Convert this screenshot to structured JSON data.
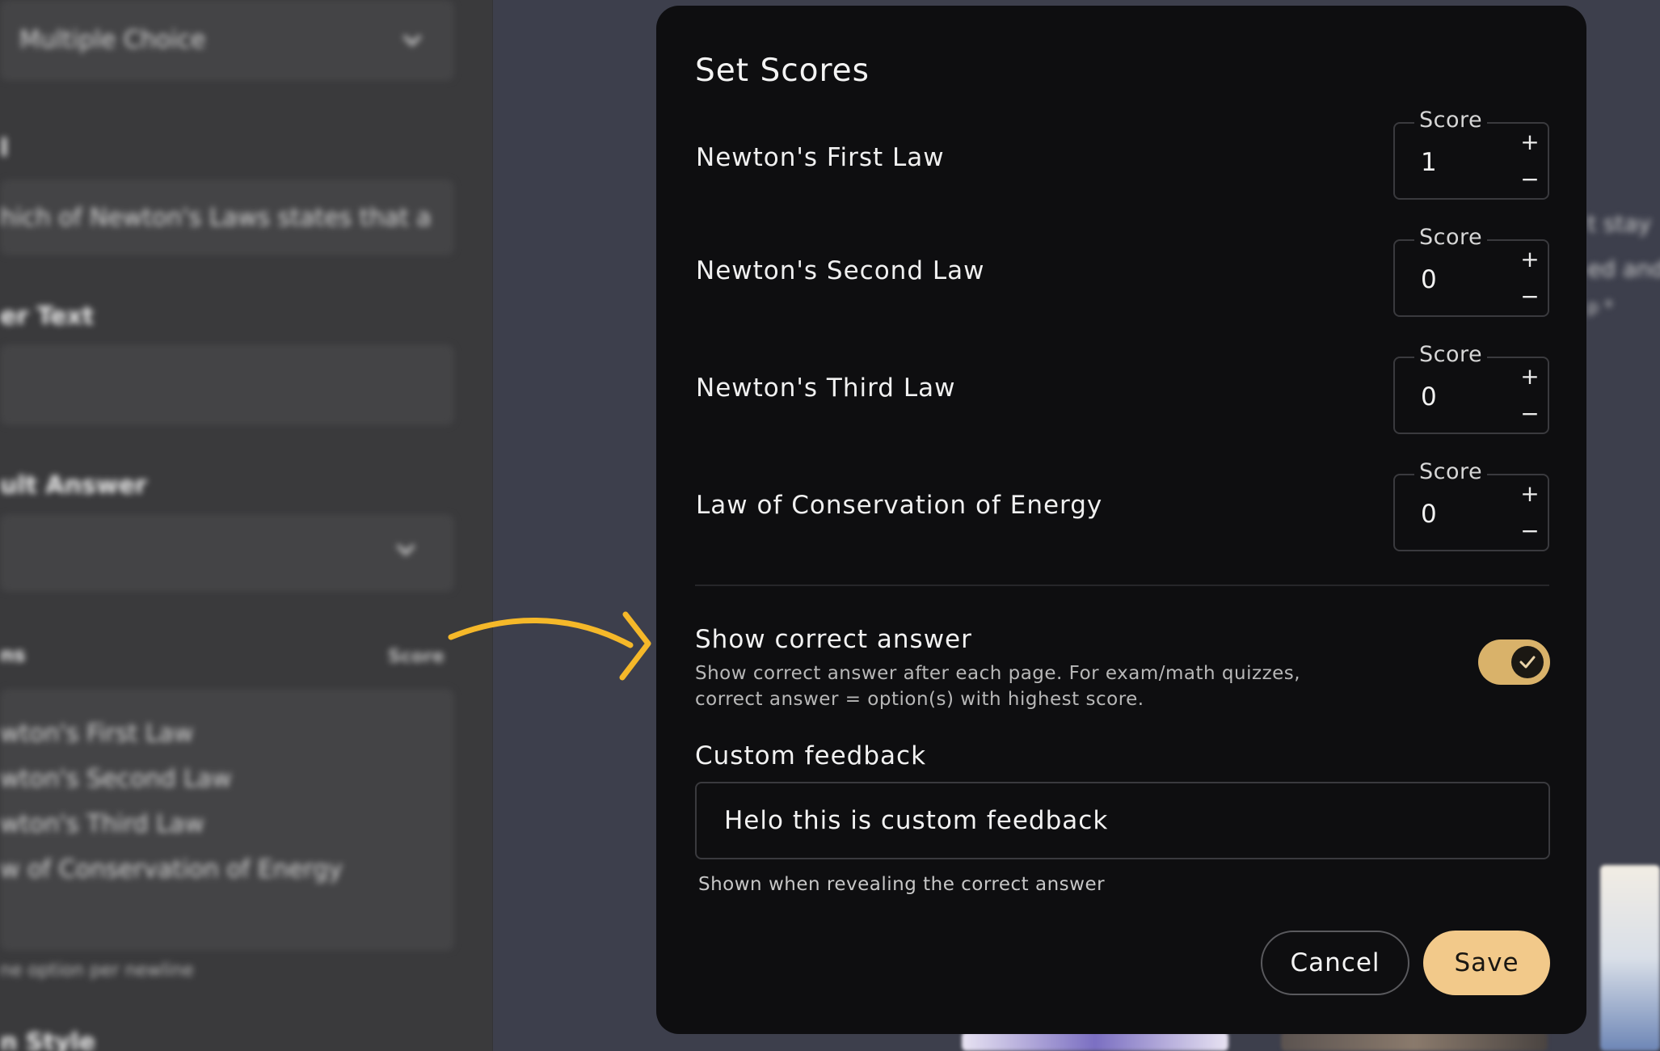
{
  "background": {
    "question_type": "Multiple Choice",
    "question_label_fragment": "l",
    "question_text_fragment": "hich of Newton's Laws states that a",
    "placeholder_label_fragment": "er Text",
    "default_answer_label_fragment": "ult Answer",
    "options_label_fragment": "ns",
    "score_link": "Score",
    "options": [
      "wton's First Law",
      "wton's Second Law",
      "wton's Third Law",
      "w of Conservation of Energy"
    ],
    "options_helper_fragment": "ne option per newline",
    "style_label_fragment": "n Style",
    "right_text_lines": [
      "t stay",
      "ed and",
      "p *"
    ]
  },
  "modal": {
    "title": "Set Scores",
    "score_field_label": "Score",
    "stepper_up": "+",
    "stepper_down": "−",
    "rows": [
      {
        "label": "Newton's First Law",
        "score": "1"
      },
      {
        "label": "Newton's Second Law",
        "score": "0"
      },
      {
        "label": "Newton's Third Law",
        "score": "0"
      },
      {
        "label": "Law of Conservation of Energy",
        "score": "0"
      }
    ],
    "show_correct": {
      "title": "Show correct answer",
      "description": "Show correct answer after each page. For exam/math quizzes, correct answer = option(s) with highest score.",
      "enabled": true
    },
    "custom_feedback": {
      "label": "Custom feedback",
      "value": "Helo this is custom feedback",
      "helper": "Shown when revealing the correct answer"
    },
    "buttons": {
      "cancel": "Cancel",
      "save": "Save"
    }
  },
  "colors": {
    "accent": "#f2c98a",
    "toggle_on": "#d9b26a",
    "modal_bg": "#0e0e10",
    "arrow": "#f5b829"
  }
}
